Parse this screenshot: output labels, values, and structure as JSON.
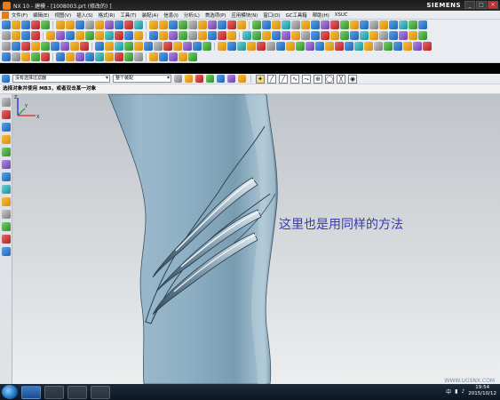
{
  "window": {
    "title": "NX 10 - 建模 - [1008003.prt  (修改的) ]",
    "brand": "SIEMENS",
    "controls": [
      "_",
      "□",
      "×"
    ]
  },
  "menu": {
    "items": [
      "文件(F)",
      "编辑(E)",
      "视图(V)",
      "插入(S)",
      "格式(R)",
      "工具(T)",
      "装配(A)",
      "信息(I)",
      "分析(L)",
      "首选项(P)",
      "应用模块(N)",
      "窗口(O)",
      "GC工具箱",
      "帮助(H)",
      "XSUC"
    ]
  },
  "filterbar": {
    "type_filter": "没有选择过滤器",
    "scope": "整个装配"
  },
  "cue": {
    "text": "选择对象并使用 MB3，或者双击某一对象"
  },
  "viewport": {
    "annotation": "这里也是用同样的方法",
    "triad": {
      "x": "X",
      "y": "Y",
      "z": "Z"
    },
    "watermark": "WWW.UGSNX.COM"
  },
  "taskbar": {
    "lang": "中",
    "time": "19:54",
    "date": "2015/10/12"
  },
  "colors": {
    "model_body": "#89abc1",
    "annotation": "#3a39b6",
    "title_bar": "#1a1a1a"
  }
}
